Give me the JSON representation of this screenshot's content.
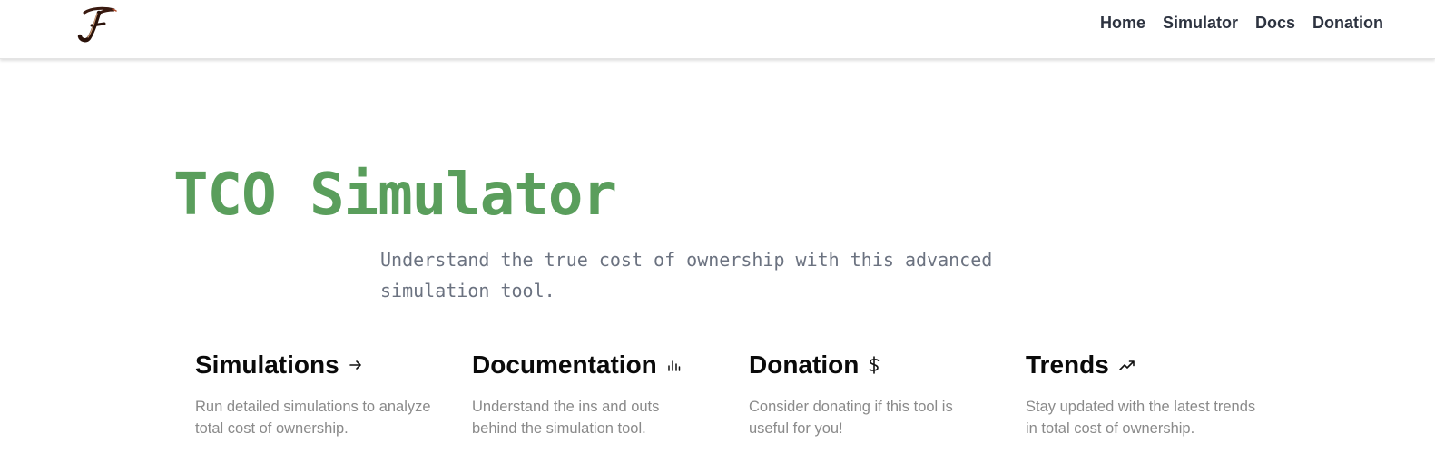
{
  "header": {
    "logo_name": "script-F-logo",
    "nav": {
      "home": "Home",
      "simulator": "Simulator",
      "docs": "Docs",
      "donation": "Donation"
    }
  },
  "hero": {
    "title": "TCO Simulator",
    "subtitle": "Understand the true cost of ownership with this advanced simulation tool.",
    "title_color": "#5a9e5c"
  },
  "features": [
    {
      "title": "Simulations",
      "icon": "arrow-right-icon",
      "description": "Run detailed simulations to analyze total cost of ownership."
    },
    {
      "title": "Documentation",
      "icon": "bar-chart-icon",
      "description": "Understand the ins and outs behind the simulation tool."
    },
    {
      "title": "Donation",
      "icon": "dollar-icon",
      "description": "Consider donating if this tool is useful for you!"
    },
    {
      "title": "Trends",
      "icon": "trending-up-icon",
      "description": "Stay updated with the latest trends in total cost of ownership."
    }
  ]
}
